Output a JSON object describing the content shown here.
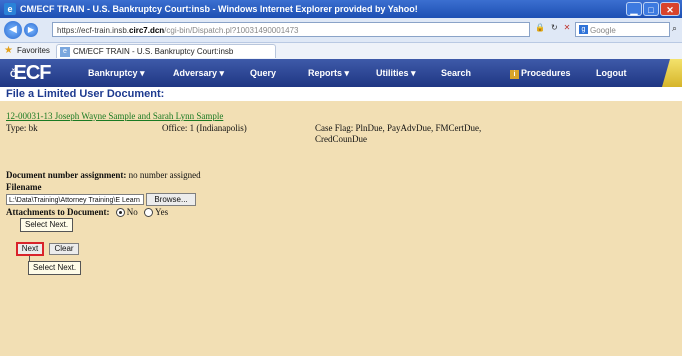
{
  "window": {
    "title": "CM/ECF TRAIN - U.S. Bankruptcy Court:insb - Windows Internet Explorer provided by Yahoo!",
    "app_icon": "ie-icon"
  },
  "address_bar": {
    "scheme_host": "https://ecf-train.insb.",
    "host_bold": "circ7.dcn",
    "path": "/cgi-bin/Dispatch.pl?10031490001473",
    "search_placeholder": "Google"
  },
  "favorites": {
    "label": "Favorites",
    "tab_label": "CM/ECF TRAIN - U.S. Bankruptcy Court:insb"
  },
  "menubar": {
    "logo_prefix": "Č",
    "logo_text": "ECF",
    "items": [
      {
        "label": "Bankruptcy ▾"
      },
      {
        "label": "Adversary ▾"
      },
      {
        "label": "Query"
      },
      {
        "label": "Reports ▾"
      },
      {
        "label": "Utilities ▾"
      },
      {
        "label": "Search"
      },
      {
        "label": "Procedures"
      },
      {
        "label": "Logout"
      }
    ]
  },
  "page": {
    "title": "File a Limited User Document:",
    "case_link": "12-00031-13 Joseph Wayne Sample and Sarah Lynn Sample",
    "type": "Type: bk",
    "office": "Office: 1 (Indianapolis)",
    "case_flag": "Case Flag: PlnDue, PayAdvDue, FMCertDue, CredCounDue",
    "doc_number_label": "Document number assignment:",
    "doc_number_value": "no number assigned",
    "filename_label": "Filename",
    "filename_value": "L:\\Data\\Training\\Attorney Training\\E Learn",
    "browse_label": "Browse...",
    "attachments_label": "Attachments to Document:",
    "attach_no": "No",
    "attach_yes": "Yes",
    "tooltip_1": "Select Next.",
    "next_label": "Next",
    "clear_label": "Clear",
    "tooltip_2": "Select Next."
  },
  "colors": {
    "menubar": "#2a4494",
    "content_bg": "#f2dfb4",
    "title_text": "#1d3a8f",
    "link": "#1a7a22",
    "highlight": "#d9232a"
  }
}
